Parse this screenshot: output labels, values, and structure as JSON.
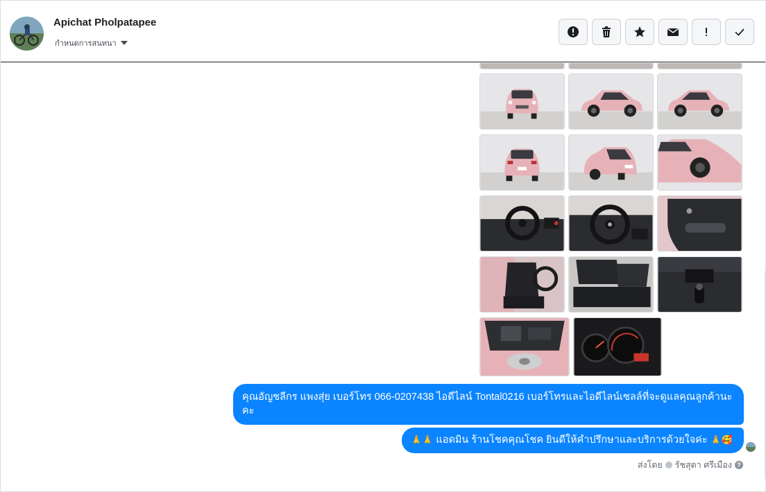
{
  "header": {
    "contact_name": "Apichat Pholpatapee",
    "assign_label": "กำหนดการสนทนา",
    "actions": [
      {
        "name": "mark-spam-button",
        "icon": "alert-circle-icon"
      },
      {
        "name": "delete-button",
        "icon": "trash-icon"
      },
      {
        "name": "star-button",
        "icon": "star-icon"
      },
      {
        "name": "mark-unread-button",
        "icon": "envelope-icon"
      },
      {
        "name": "follow-up-button",
        "icon": "exclamation-icon"
      },
      {
        "name": "mark-done-button",
        "icon": "checkmark-icon"
      }
    ]
  },
  "gallery": {
    "rows": [
      [
        "car-front",
        "car-side-right",
        "car-side-left"
      ],
      [
        "car-rear",
        "car-rear-quarter",
        "car-front-quarter"
      ],
      [
        "dashboard-left",
        "dashboard-steering",
        "door-panel"
      ],
      [
        "front-seat",
        "rear-seats",
        "center-console"
      ],
      [
        "engine-bay",
        "gauge-cluster"
      ]
    ]
  },
  "messages": {
    "bubble1_text": "คุณอัญชลีกร แพงสุ่ย      เบอร์โทร 066-0207438 ไอดีไลน์ Tontal0216   เบอร์โทรและไอดีไลน์เซลล์ที่จะดูแลคุณลูกค้านะคะ",
    "bubble2_emoji_start": "🙏🙏",
    "bubble2_text": "แอดมิน ร้านโชคคุณโชค ยินดีให้คำปรึกษาและบริการด้วยใจค่ะ",
    "bubble2_emoji_end": "🙏🥰"
  },
  "footer": {
    "sent_by_label": "ส่งโดย",
    "sender_name": "รัชสุดา ศรีเมือง",
    "help_glyph": "?"
  },
  "colors": {
    "bubble": "#0b84ff",
    "car_pink": "#e6b2b8",
    "interior": "#2b2c30"
  }
}
